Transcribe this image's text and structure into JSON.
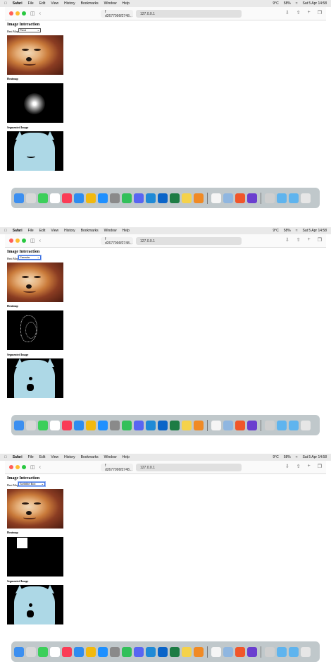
{
  "menubar": {
    "apple": "",
    "items": [
      "Safari",
      "File",
      "Edit",
      "View",
      "History",
      "Bookmarks",
      "Window",
      "Help"
    ],
    "status": [
      "9°C",
      "58%",
      "Sat 5 Apr 14:58"
    ]
  },
  "browser": {
    "tab_inactive": "f d2677096f2748...",
    "tab_active": "127.0.0.1"
  },
  "page": {
    "title": "Image Interaction",
    "select_label": "Heat Map:",
    "heatmap_label": "Heatmap",
    "segmented_label": "Segmented Image"
  },
  "shots": [
    {
      "select_value": "Pivot"
    },
    {
      "select_value": "Canada"
    },
    {
      "select_value": "Scribble Box"
    }
  ],
  "colors": {
    "segment_blue": "#add8e6",
    "heat_bg": "#000000",
    "focus_ring": "#3b6fe0"
  },
  "dock": {
    "apps": [
      "finder-icon",
      "launchpad-icon",
      "messages-icon",
      "calendar-icon",
      "music-icon",
      "safari-icon",
      "chrome-icon",
      "appstore-icon",
      "settings-icon",
      "facetime-icon",
      "discord-icon",
      "vscode-icon",
      "outlook-icon",
      "excel-icon",
      "notes-icon",
      "books-icon",
      "textedit-icon",
      "preview-icon",
      "brave-icon",
      "imovie-icon",
      "screenshot-icon",
      "folder-icon",
      "downloads-icon",
      "trash-icon"
    ]
  }
}
